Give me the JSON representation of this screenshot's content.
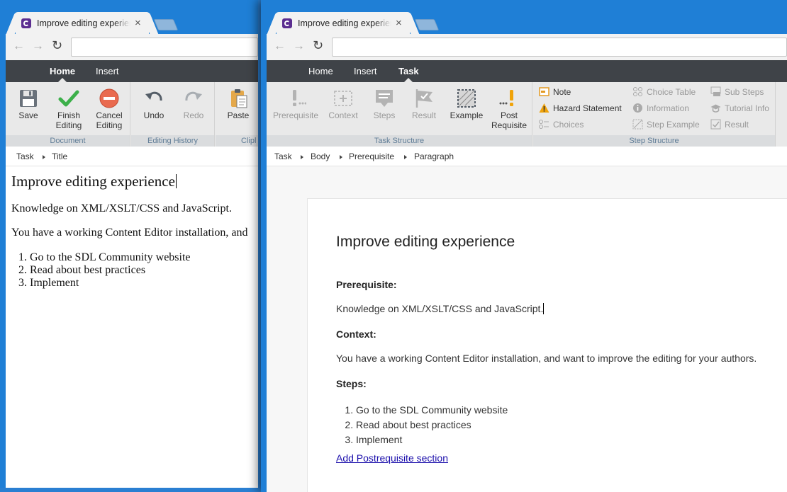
{
  "browser": {
    "tab_title": "Improve editing experience",
    "tab_close": "×",
    "nav": {
      "back": "←",
      "forward": "→",
      "reload": "↻"
    }
  },
  "left_window": {
    "ribbon_tabs": [
      "Home",
      "Insert"
    ],
    "active_tab": "Home",
    "groups": [
      {
        "label": "Document",
        "buttons": [
          {
            "label": "Save",
            "icon": "save-icon"
          },
          {
            "label": "Finish Editing",
            "icon": "checkmark-icon"
          },
          {
            "label": "Cancel Editing",
            "icon": "cancel-icon"
          }
        ]
      },
      {
        "label": "Editing History",
        "buttons": [
          {
            "label": "Undo",
            "icon": "undo-icon"
          },
          {
            "label": "Redo",
            "icon": "redo-icon",
            "disabled": true
          }
        ]
      },
      {
        "label": "Clipl",
        "buttons": [
          {
            "label": "Paste",
            "icon": "paste-icon"
          }
        ]
      }
    ],
    "breadcrumb": [
      "Task",
      "Title"
    ],
    "content": {
      "title": "Improve editing experience",
      "para1": "Knowledge on XML/XSLT/CSS and JavaScript.",
      "para2": "You have a working Content Editor installation, and",
      "steps": [
        "Go to the SDL Community website",
        "Read about best practices",
        "Implement"
      ]
    }
  },
  "right_window": {
    "ribbon_tabs": [
      "Home",
      "Insert",
      "Task"
    ],
    "active_tab": "Task",
    "task_structure": {
      "label": "Task Structure",
      "buttons": [
        {
          "label": "Prerequisite",
          "icon": "prerequisite-icon",
          "disabled": true
        },
        {
          "label": "Context",
          "icon": "context-icon",
          "disabled": true
        },
        {
          "label": "Steps",
          "icon": "steps-icon",
          "disabled": true
        },
        {
          "label": "Result",
          "icon": "result-flag-icon",
          "disabled": true
        },
        {
          "label": "Example",
          "icon": "example-icon"
        },
        {
          "label": "Post Requisite",
          "icon": "post-requisite-icon"
        }
      ]
    },
    "step_structure": {
      "label": "Step Structure",
      "items": [
        {
          "label": "Note",
          "icon": "note-icon"
        },
        {
          "label": "Hazard Statement",
          "icon": "hazard-icon"
        },
        {
          "label": "Choices",
          "icon": "choices-icon",
          "disabled": true
        },
        {
          "label": "Choice Table",
          "icon": "choice-table-icon",
          "disabled": true
        },
        {
          "label": "Information",
          "icon": "information-icon",
          "disabled": true
        },
        {
          "label": "Step Example",
          "icon": "step-example-icon",
          "disabled": true
        },
        {
          "label": "Sub Steps",
          "icon": "sub-steps-icon",
          "disabled": true
        },
        {
          "label": "Tutorial Info",
          "icon": "tutorial-info-icon",
          "disabled": true
        },
        {
          "label": "Result",
          "icon": "result-check-icon",
          "disabled": true
        }
      ]
    },
    "breadcrumb": [
      "Task",
      "Body",
      "Prerequisite",
      "Paragraph"
    ],
    "document": {
      "title": "Improve editing experience",
      "prereq_label": "Prerequisite:",
      "prereq_text": "Knowledge on XML/XSLT/CSS and JavaScript.",
      "context_label": "Context:",
      "context_text": "You have a working Content Editor installation, and want to improve the editing for your authors.",
      "steps_label": "Steps:",
      "steps": [
        "Go to the SDL Community website",
        "Read about best practices",
        "Implement"
      ],
      "link": "Add Postrequisite section"
    }
  },
  "colors": {
    "window_frame": "#1f7fd6",
    "ribbon_tabs_bg": "#3f4348",
    "ribbon_bg": "#e9e9e9",
    "group_label": "#5f7c96",
    "accent_green": "#3cb04a",
    "cancel_red": "#e96a4f",
    "warning_orange": "#f0a30a",
    "link": "#1a0dab"
  }
}
